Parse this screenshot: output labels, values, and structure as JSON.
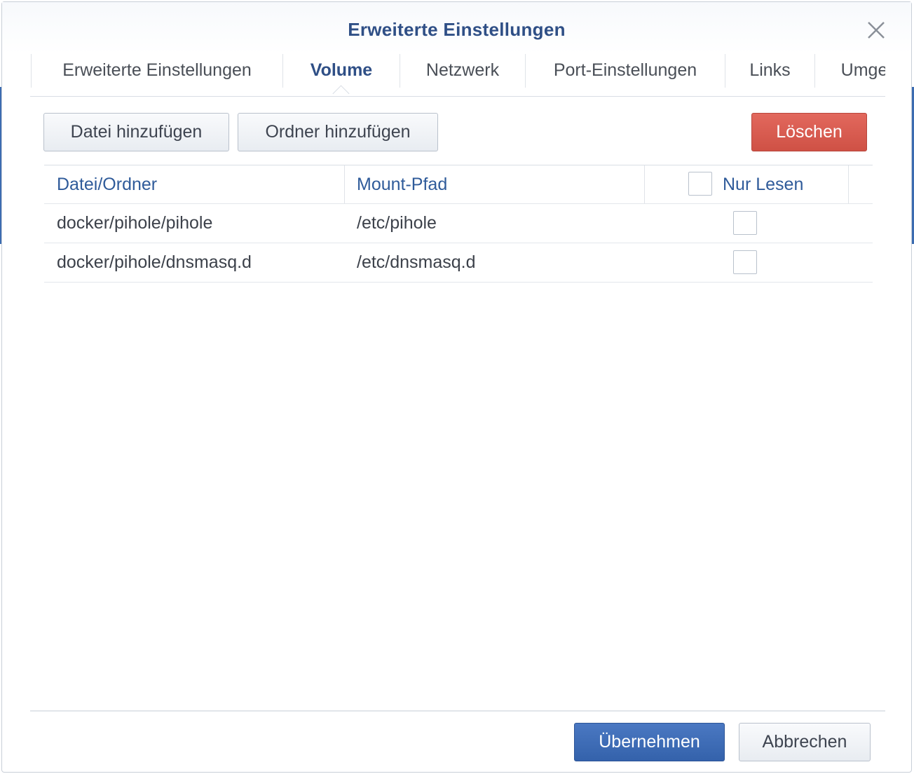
{
  "dialog": {
    "title": "Erweiterte Einstellungen",
    "close_icon": "close-icon"
  },
  "tabs": [
    {
      "label": "Erweiterte Einstellungen",
      "active": false
    },
    {
      "label": "Volume",
      "active": true
    },
    {
      "label": "Netzwerk",
      "active": false
    },
    {
      "label": "Port-Einstellungen",
      "active": false
    },
    {
      "label": "Links",
      "active": false
    },
    {
      "label": "Umge",
      "active": false
    }
  ],
  "toolbar": {
    "add_file_label": "Datei hinzufügen",
    "add_folder_label": "Ordner hinzufügen",
    "delete_label": "Löschen"
  },
  "table": {
    "columns": [
      "Datei/Ordner",
      "Mount-Pfad",
      "Nur Lesen"
    ],
    "header_readonly_checked": false,
    "rows": [
      {
        "path": "docker/pihole/pihole",
        "mount": "/etc/pihole",
        "readonly": false
      },
      {
        "path": "docker/pihole/dnsmasq.d",
        "mount": "/etc/dnsmasq.d",
        "readonly": false
      }
    ]
  },
  "footer": {
    "apply_label": "Übernehmen",
    "cancel_label": "Abbrechen"
  },
  "colors": {
    "accent": "#2f4f86",
    "danger": "#d6584c",
    "primary": "#3c6bb6"
  }
}
